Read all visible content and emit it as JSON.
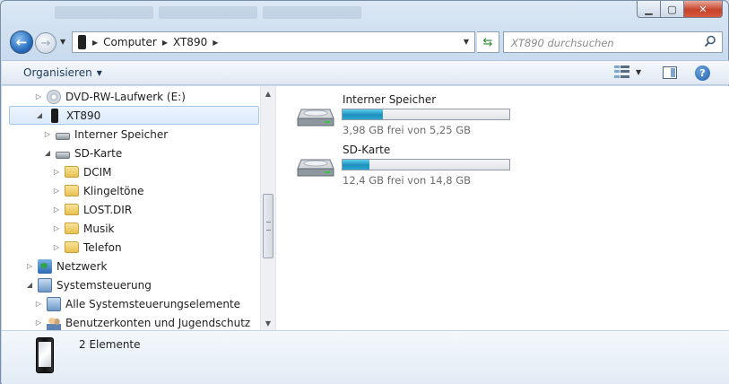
{
  "window": {
    "controls": {
      "minimize": "▁",
      "maximize": "▢",
      "close": "✕"
    }
  },
  "nav": {
    "back_icon": "back-arrow-icon",
    "forward_icon": "forward-arrow-icon",
    "breadcrumbs": [
      "Computer",
      "XT890"
    ],
    "search_placeholder": "XT890 durchsuchen"
  },
  "toolbar": {
    "organize_label": "Organisieren"
  },
  "tree": {
    "items": [
      {
        "label": "DVD-RW-Laufwerk (E:)",
        "icon": "dvd-drive-icon",
        "expander": "▷"
      },
      {
        "label": "XT890",
        "icon": "phone-icon",
        "expander": "◢",
        "selected": true
      },
      {
        "label": "Interner Speicher",
        "icon": "drive-icon",
        "expander": "▷"
      },
      {
        "label": "SD-Karte",
        "icon": "drive-icon",
        "expander": "◢"
      },
      {
        "label": "DCIM",
        "icon": "folder-icon",
        "expander": "▷"
      },
      {
        "label": "Klingeltöne",
        "icon": "folder-icon",
        "expander": "▷"
      },
      {
        "label": "LOST.DIR",
        "icon": "folder-icon",
        "expander": "▷"
      },
      {
        "label": "Musik",
        "icon": "folder-icon",
        "expander": "▷"
      },
      {
        "label": "Telefon",
        "icon": "folder-icon",
        "expander": "▷"
      },
      {
        "label": "Netzwerk",
        "icon": "network-icon",
        "expander": "▷"
      },
      {
        "label": "Systemsteuerung",
        "icon": "control-panel-icon",
        "expander": "◢"
      },
      {
        "label": "Alle Systemsteuerungselemente",
        "icon": "control-panel-icon",
        "expander": "▷"
      },
      {
        "label": "Benutzerkonten und Jugendschutz",
        "icon": "users-icon",
        "expander": "▷"
      }
    ]
  },
  "drives": [
    {
      "name": "Interner Speicher",
      "free_text": "3,98 GB frei von 5,25 GB",
      "used_fraction": 0.242
    },
    {
      "name": "SD-Karte",
      "free_text": "12,4 GB frei von 14,8 GB",
      "used_fraction": 0.162
    }
  ],
  "status": {
    "count_text": "2 Elemente"
  }
}
